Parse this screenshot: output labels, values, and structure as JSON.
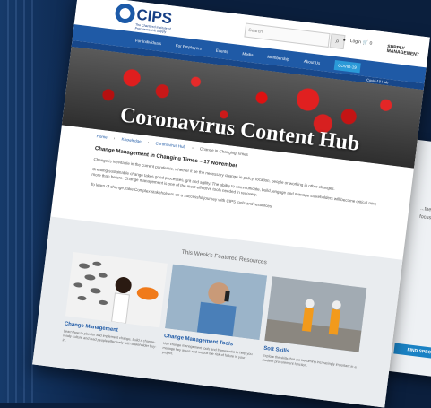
{
  "brand": {
    "logo_text": "CIPS",
    "logo_subtext": "The Chartered Institute of Procurement & Supply",
    "partner_logo": "SUPPLY MANAGEMENT"
  },
  "topbar": {
    "search_placeholder": "Search",
    "search_icon": "search-icon",
    "account_label": "Login",
    "cart_label": "0"
  },
  "nav": {
    "items": [
      {
        "label": "For Individuals"
      },
      {
        "label": "For Employers"
      },
      {
        "label": "Events"
      },
      {
        "label": "Media"
      },
      {
        "label": "Membership"
      },
      {
        "label": "About Us"
      }
    ],
    "active_label": "COVID-19",
    "sub_label": "Covid-19 Hub"
  },
  "hero": {
    "title": "Coronavirus Content Hub"
  },
  "breadcrumb": [
    "Home",
    "Knowledge",
    "Coronavirus Hub",
    "Change in Changing Times"
  ],
  "article": {
    "title": "Change Management in Changing Times – 17 November",
    "paragraphs": [
      "Change is inevitable in the current pandemic, whether it be the necessary change in policy, location, people or working in other changes.",
      "Creating sustainable change takes good processes, grit and agility. The ability to communicate, build, engage and manage stakeholders will become critical now, more than before. Change management is one of the most effective tools needed in recovery.",
      "To learn of change, take Complex stakeholders on a successful journey with CIPS tools and resources."
    ]
  },
  "featured": {
    "heading": "This Week's Featured Resources",
    "cards": [
      {
        "title": "Change Management",
        "desc": "Learn how to plan for and implement change, build a change-ready culture and lead people effectively with stakeholder buy-in."
      },
      {
        "title": "Change Management Tools",
        "desc": "Use change management tools and frameworks to help you manage key areas and reduce the risk of failure in your project."
      },
      {
        "title": "Soft Skills",
        "desc": "Explore the skills that are becoming increasingly important in a modern procurement function."
      }
    ]
  },
  "back_page": {
    "text": "...the sin of our time... a focus on... build and...",
    "button_label": "FIND SPECIF..."
  },
  "colors": {
    "nav_blue": "#1f5aa6",
    "accent_blue": "#2b9ad8",
    "hero_red": "#e01e1e"
  }
}
